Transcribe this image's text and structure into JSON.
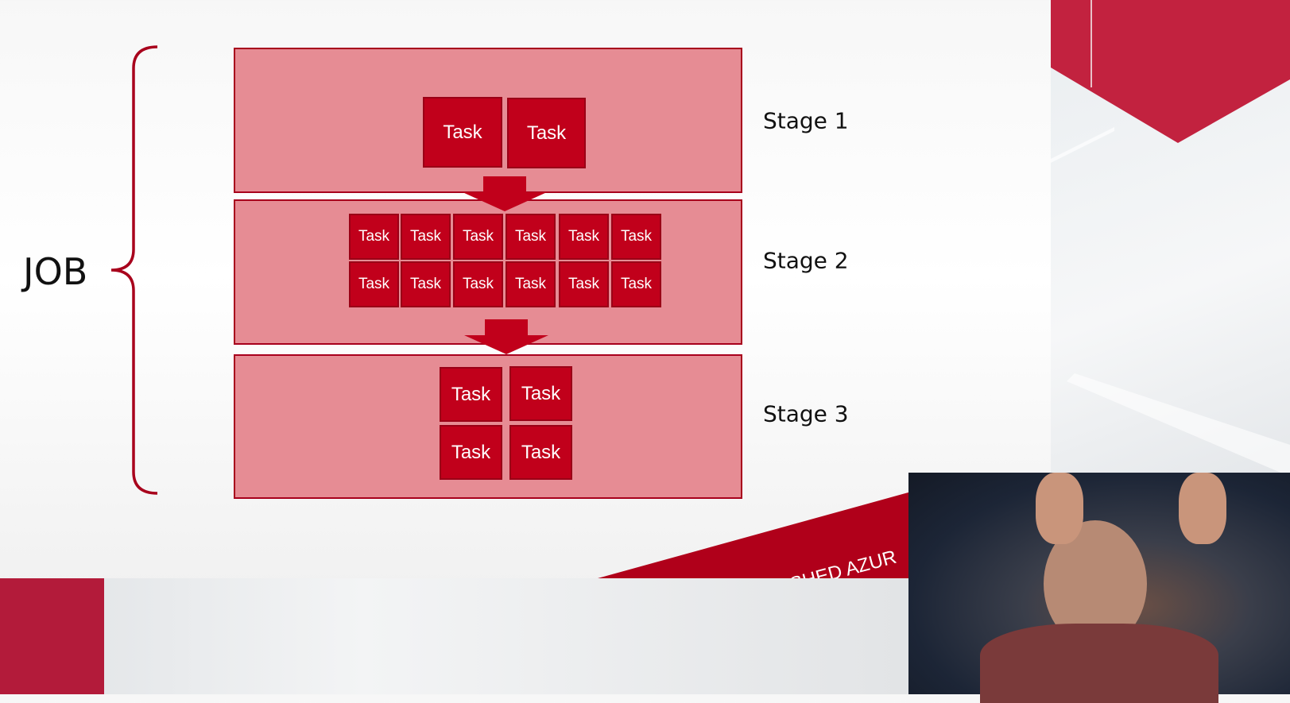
{
  "slide": {
    "job_label": "JOB",
    "stages": [
      {
        "label": "Stage 1",
        "tasks": [
          "Task",
          "Task"
        ]
      },
      {
        "label": "Stage 2",
        "tasks": [
          "Task",
          "Task",
          "Task",
          "Task",
          "Task",
          "Task",
          "Task",
          "Task",
          "Task",
          "Task",
          "Task",
          "Task"
        ]
      },
      {
        "label": "Stage 3",
        "tasks": [
          "Task",
          "Task",
          "Task",
          "Task"
        ]
      }
    ],
    "banner_text": "...SHED  AZUR"
  },
  "colors": {
    "stage_fill": "#e68c94",
    "stage_border": "#a8001c",
    "task_fill": "#c1001b",
    "accent_red": "#a8001c",
    "banner_red": "#b0001a"
  }
}
